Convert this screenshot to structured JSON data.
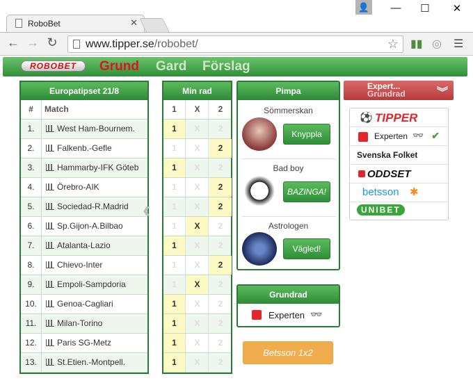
{
  "browser": {
    "tab_title": "RoboBet",
    "url_host": "www.tipper.se",
    "url_path": "/robobet/"
  },
  "nav": {
    "logo": "ROBOBET",
    "links": [
      "Grund",
      "Gard",
      "Förslag"
    ]
  },
  "left_table": {
    "title": "Europatipset 21/8",
    "col_num": "#",
    "col_match": "Match",
    "matches": [
      "West Ham-Bournem.",
      "Falkenb.-Gefle",
      "Hammarby-IFK Göteb",
      "Örebro-AIK",
      "Sociedad-R.Madrid",
      "Sp.Gijon-A.Bilbao",
      "Atalanta-Lazio",
      "Chievo-Inter",
      "Empoli-Sampdoria",
      "Genoa-Cagliari",
      "Milan-Torino",
      "Paris SG-Metz",
      "St.Etien.-Montpell."
    ],
    "numbers": [
      "1.",
      "2.",
      "3.",
      "4.",
      "5.",
      "6.",
      "7.",
      "8.",
      "9.",
      "10.",
      "11.",
      "12.",
      "13."
    ]
  },
  "my_row": {
    "title": "Min rad",
    "cols": [
      "1",
      "X",
      "2"
    ],
    "picks": [
      "1",
      "2",
      "1",
      "2",
      "2",
      "X",
      "1",
      "2",
      "X",
      "1",
      "1",
      "1",
      "1"
    ]
  },
  "pimpa": {
    "title": "Pimpa",
    "personas": [
      {
        "name": "Sömmerskan",
        "button": "Knyppla"
      },
      {
        "name": "Bad boy",
        "button": "BAZINGA!"
      },
      {
        "name": "Astrologen",
        "button": "Vägled!"
      }
    ]
  },
  "grundrad": {
    "title": "Grundrad",
    "value": "Experten"
  },
  "betsson_button": "Betsson 1x2",
  "expert": {
    "line1": "Expert...",
    "line2": "Grundrad",
    "options": [
      "TIPPER",
      "Experten",
      "Svenska Folket",
      "ODDSET",
      "betsson",
      "UNIBET"
    ]
  },
  "colors": {
    "green": "#2f8f38",
    "red": "#e0151b",
    "highlight": "#fdf9c4",
    "orange": "#f0ad4e"
  }
}
